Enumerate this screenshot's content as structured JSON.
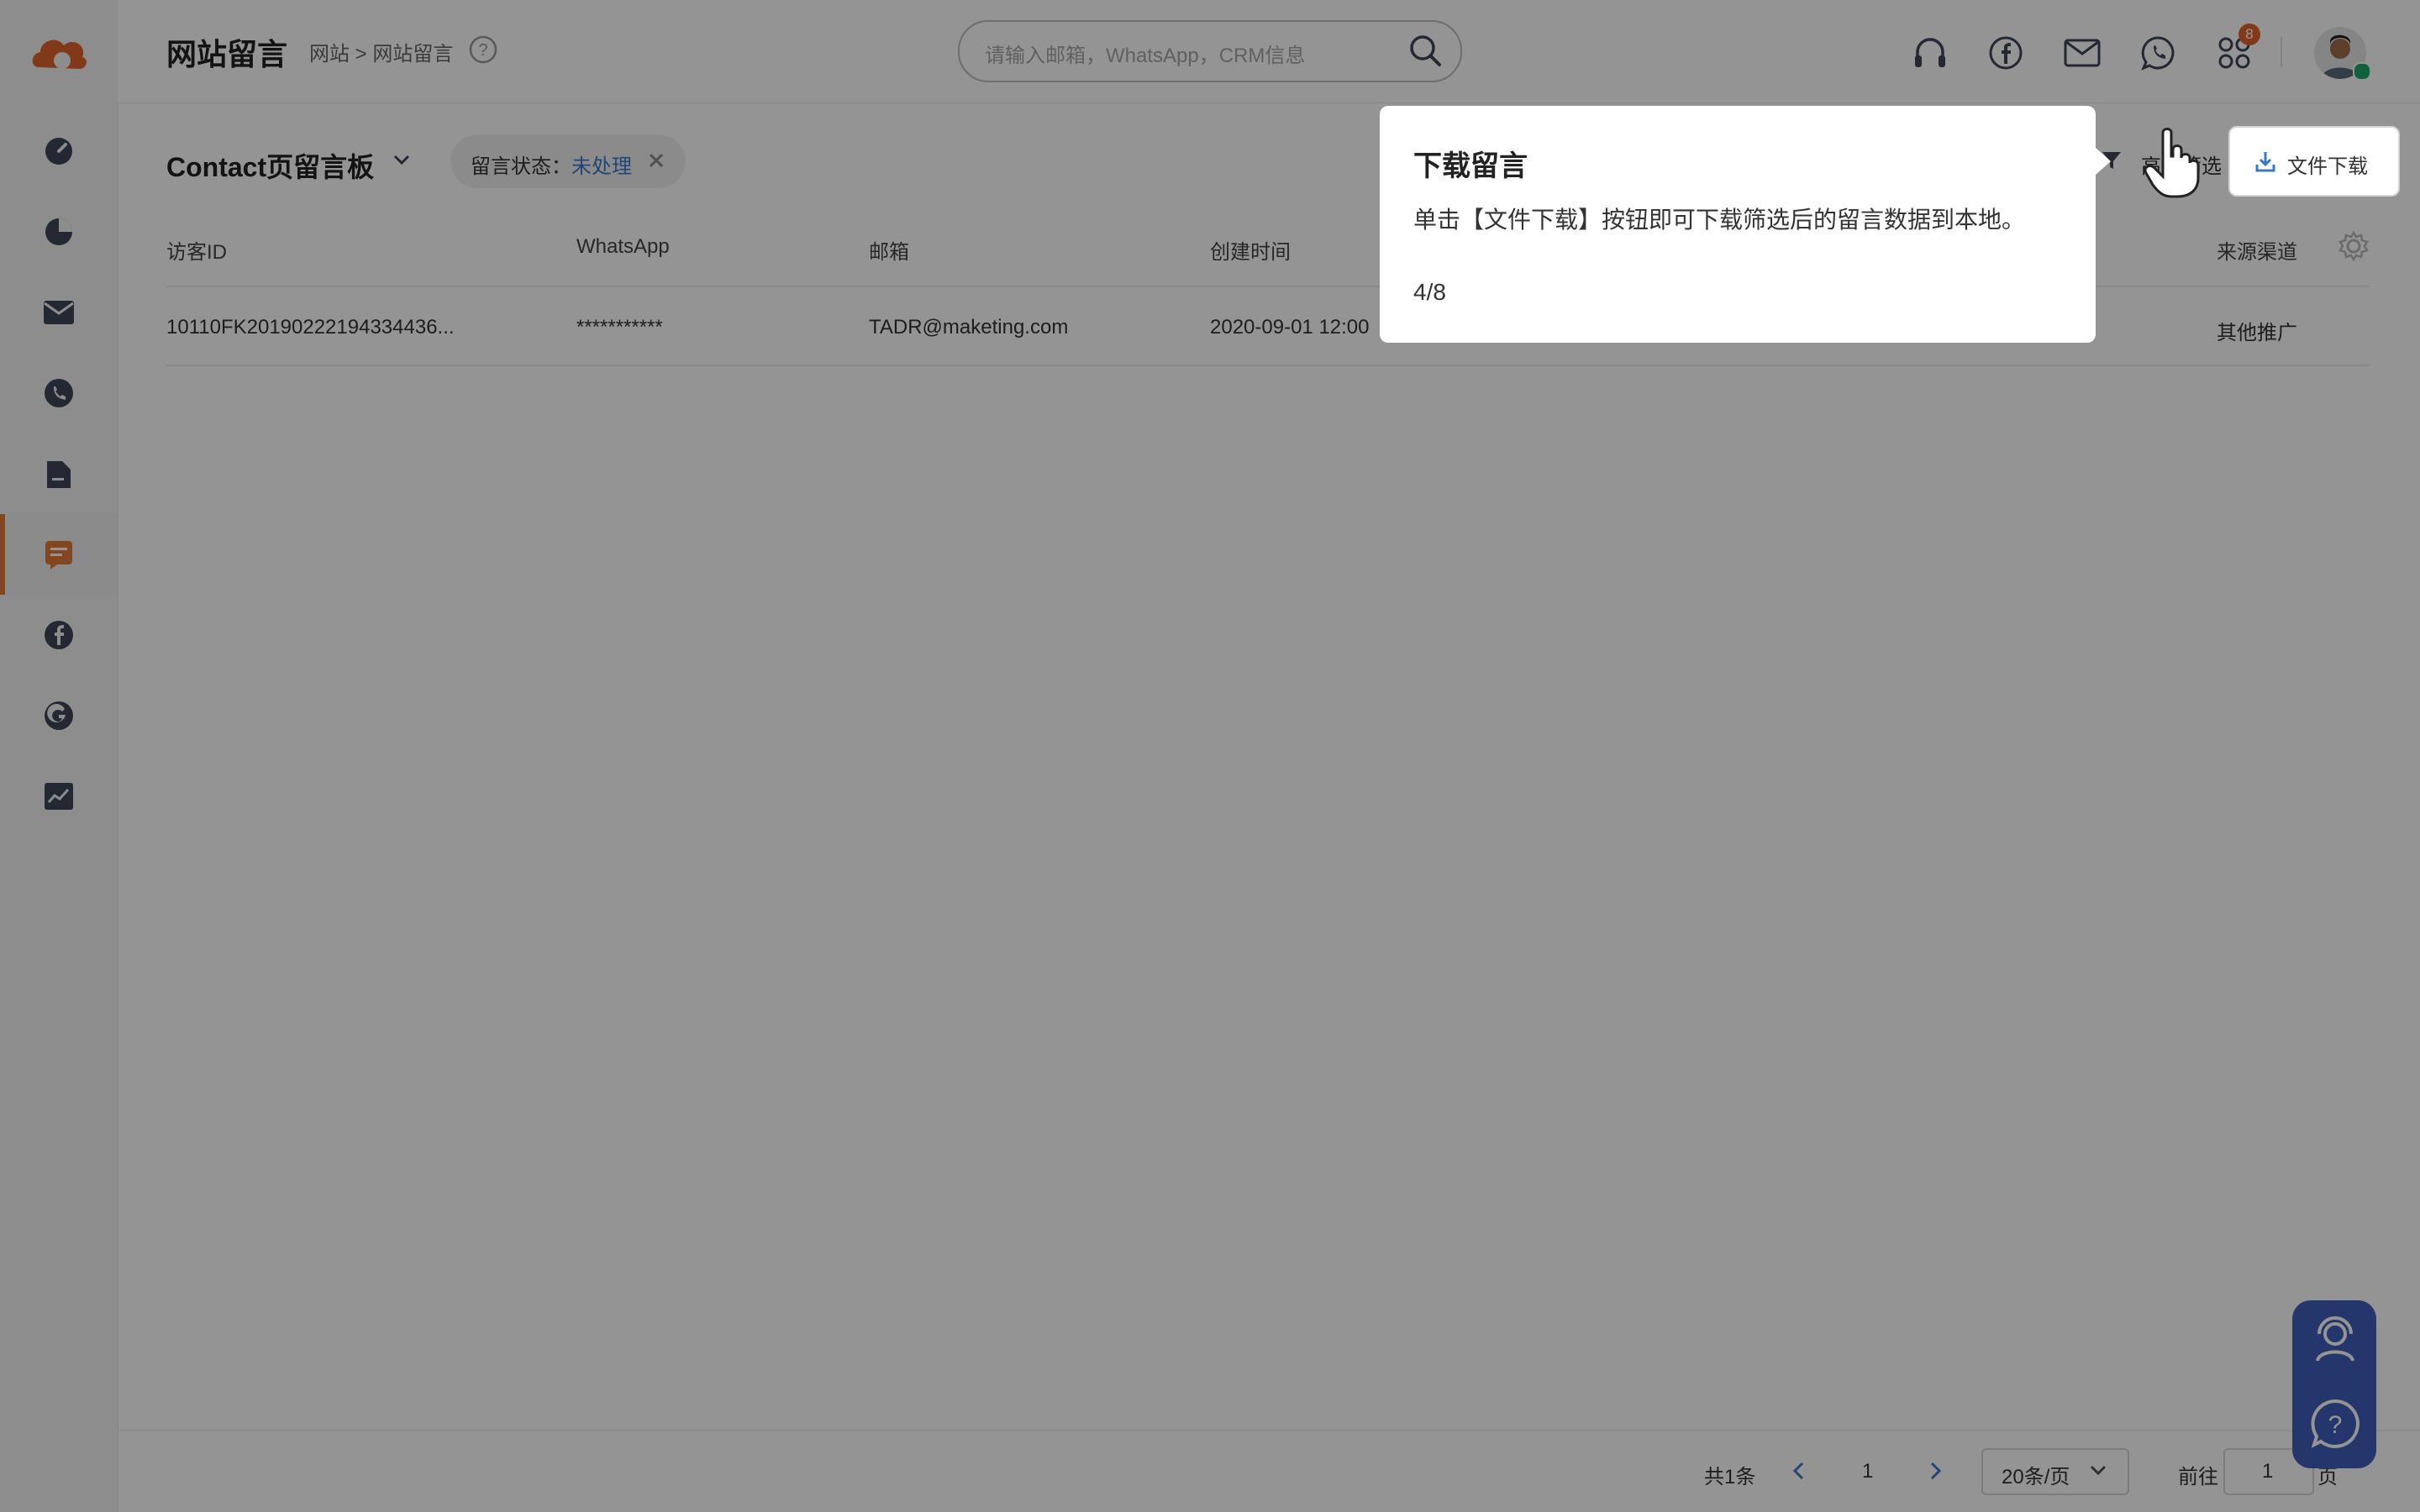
{
  "header": {
    "title": "网站留言",
    "breadcrumb": "网站 > 网站留言",
    "search_placeholder": "请输入邮箱，WhatsApp，CRM信息",
    "notification_count": "8"
  },
  "sidebar": {
    "items": [
      "dashboard-icon",
      "analytics-icon",
      "mail-icon",
      "phone-icon",
      "file-icon",
      "message-board-icon",
      "facebook-icon",
      "google-icon",
      "report-icon"
    ],
    "active_index": 5,
    "accent_color": "#e07a3a"
  },
  "content": {
    "board_title": "Contact页留言板",
    "filter_chip": {
      "label": "留言状态：",
      "value": "未处理"
    },
    "filter_button_label": "高级筛选",
    "download_label": "文件下载",
    "table": {
      "headers": [
        "访客ID",
        "WhatsApp",
        "邮箱",
        "创建时间",
        "来源渠道"
      ],
      "rows": [
        [
          "10110FK20190222194334436...",
          "***********",
          "TADR@maketing.com",
          "2020-09-01 12:00",
          "其他推广"
        ]
      ]
    }
  },
  "pagination": {
    "total": "共1条",
    "current_page": "1",
    "page_size": "20条/页",
    "goto_label": "前往",
    "goto_value": "1",
    "page_suffix": "页"
  },
  "tour": {
    "title": "下载留言",
    "body": "单击【文件下载】按钮即可下载筛选后的留言数据到本地。",
    "step": "4/8"
  }
}
